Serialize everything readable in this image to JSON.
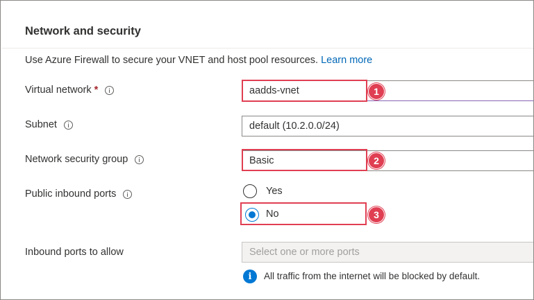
{
  "section": {
    "title": "Network and security",
    "description": "Use Azure Firewall to secure your VNET and host pool resources.",
    "learn_more": "Learn more"
  },
  "fields": {
    "virtual_network": {
      "label": "Virtual network",
      "required_mark": "*",
      "value": "aadds-vnet"
    },
    "subnet": {
      "label": "Subnet",
      "value": "default (10.2.0.0/24)"
    },
    "nsg": {
      "label": "Network security group",
      "value": "Basic"
    },
    "public_inbound": {
      "label": "Public inbound ports",
      "options": [
        {
          "label": "Yes",
          "checked": false
        },
        {
          "label": "No",
          "checked": true
        }
      ]
    },
    "inbound_ports": {
      "label": "Inbound ports to allow",
      "placeholder": "Select one or more ports",
      "info_note": "All traffic from the internet will be blocked by default."
    }
  },
  "callouts": [
    "1",
    "2",
    "3"
  ],
  "colors": {
    "accent": "#0078d4",
    "callout": "#e03e52",
    "link": "#0067b8"
  }
}
